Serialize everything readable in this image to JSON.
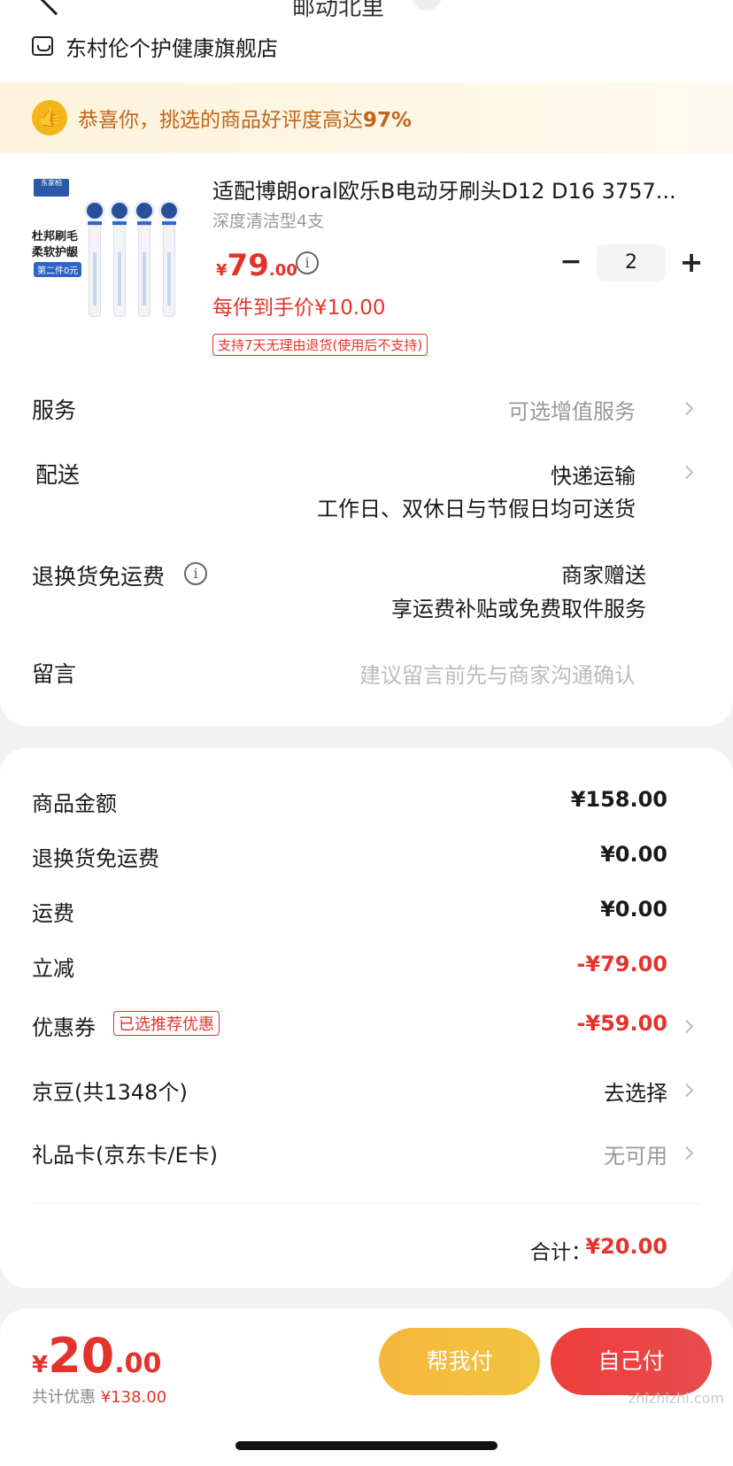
{
  "header": {
    "address": "邮动北里"
  },
  "shop": {
    "name": "东村伦个护健康旗舰店"
  },
  "banner": {
    "text": "恭喜你，挑选的商品好评度高达",
    "rate": "97%"
  },
  "product": {
    "image_brand": "东家柏",
    "image_text_1": "杜邦刷毛",
    "image_text_2": "柔软护龈",
    "image_badge": "第二件0元",
    "title": "适配博朗oral欧乐B电动牙刷头D12 D16 3757...",
    "spec": "深度清洁型4支",
    "price_yen": "¥",
    "price_int": "79",
    "price_dec": ".00",
    "unit_price": "每件到手价¥10.00",
    "return_policy": "支持7天无理由退货(使用后不支持)",
    "quantity": "2",
    "minus": "−",
    "plus": "+"
  },
  "rows": {
    "service_label": "服务",
    "service_value": "可选增值服务",
    "delivery_label": "配送",
    "delivery_value": "快递运输",
    "delivery_note": "工作日、双休日与节假日均可送货",
    "return_shipping_label": "退换货免运费",
    "return_shipping_value": "商家赠送",
    "return_shipping_note": "享运费补贴或免费取件服务",
    "message_label": "留言",
    "message_placeholder": "建议留言前先与商家沟通确认"
  },
  "summary": {
    "goods_amount_label": "商品金额",
    "goods_amount_value": "¥158.00",
    "return_free_label": "退换货免运费",
    "return_free_value": "¥0.00",
    "shipping_label": "运费",
    "shipping_value": "¥0.00",
    "instant_discount_label": "立减",
    "instant_discount_value": "-¥79.00",
    "coupon_label": "优惠券",
    "coupon_tag": "已选推荐优惠",
    "coupon_value": "-¥59.00",
    "jingdou_label": "京豆(共1348个)",
    "jingdou_value": "去选择",
    "giftcard_label": "礼品卡(京东卡/E卡)",
    "giftcard_value": "无可用",
    "total_label": "合计：",
    "total_value": "¥20.00"
  },
  "footer": {
    "pay_yen": "¥",
    "pay_int": "20",
    "pay_dec": ".00",
    "discount_label": "共计优惠",
    "discount_value": "¥138.00",
    "help_pay": "帮我付",
    "self_pay": "自己付",
    "watermark": "zhizhizhi.com"
  },
  "colors": {
    "accent_red": "#e4332b",
    "banner_text": "#c0651b",
    "help_pay_btn": "#f3bd3e",
    "self_pay_btn": "#ec4343"
  }
}
